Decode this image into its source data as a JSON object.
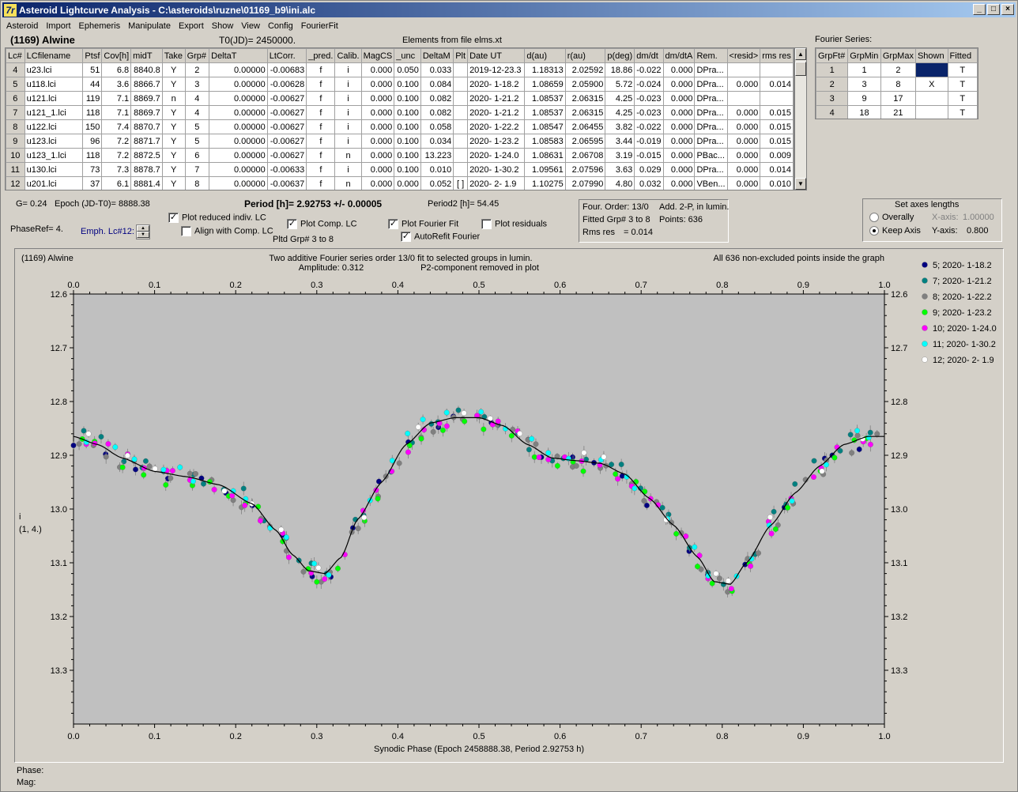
{
  "window": {
    "title": "Asteroid Lightcurve Analysis - C:\\asteroids\\ruzne\\01169_b9\\ini.alc",
    "icon": "7r"
  },
  "menu": [
    "Asteroid",
    "Import",
    "Ephemeris",
    "Manipulate",
    "Export",
    "Show",
    "View",
    "Config",
    "FourierFit"
  ],
  "header": {
    "asteroid": "(1169) Alwine",
    "t0": "T0(JD)= 2450000.",
    "elements": "Elements from file elms.xt",
    "fourier_series_label": "Fourier Series:"
  },
  "lc_table": {
    "columns": [
      "Lc#",
      "LCfilename",
      "Ptsf",
      "Cov[h]",
      "midT",
      "Take",
      "Grp#",
      "DeltaT",
      "LtCorr.",
      "_pred.",
      "Calib.",
      "MagCS",
      "_unc",
      "DeltaM",
      "Plt",
      "Date UT",
      "d(au)",
      "r(au)",
      "p(deg)",
      "dm/dt",
      "dm/dtA",
      "Rem.",
      "<resid>",
      "rms res"
    ],
    "rows": [
      [
        "4",
        "u23.lci",
        "51",
        "6.8",
        "8840.8",
        "Y",
        "2",
        "0.00000",
        "-0.00683",
        "f",
        "i",
        "0.000",
        "0.050",
        "0.033",
        "",
        "2019-12-23.3",
        "1.18313",
        "2.02592",
        "18.86",
        "-0.022",
        "0.000",
        "DPra...",
        "",
        ""
      ],
      [
        "5",
        "u118.lci",
        "44",
        "3.6",
        "8866.7",
        "Y",
        "3",
        "0.00000",
        "-0.00628",
        "f",
        "i",
        "0.000",
        "0.100",
        "0.084",
        "",
        "2020- 1-18.2",
        "1.08659",
        "2.05900",
        "5.72",
        "-0.024",
        "0.000",
        "DPra...",
        "0.000",
        "0.014"
      ],
      [
        "6",
        "u121.lci",
        "119",
        "7.1",
        "8869.7",
        "n",
        "4",
        "0.00000",
        "-0.00627",
        "f",
        "i",
        "0.000",
        "0.100",
        "0.082",
        "",
        "2020- 1-21.2",
        "1.08537",
        "2.06315",
        "4.25",
        "-0.023",
        "0.000",
        "DPra...",
        "",
        ""
      ],
      [
        "7",
        "u121_1.lci",
        "118",
        "7.1",
        "8869.7",
        "Y",
        "4",
        "0.00000",
        "-0.00627",
        "f",
        "i",
        "0.000",
        "0.100",
        "0.082",
        "",
        "2020- 1-21.2",
        "1.08537",
        "2.06315",
        "4.25",
        "-0.023",
        "0.000",
        "DPra...",
        "0.000",
        "0.015"
      ],
      [
        "8",
        "u122.lci",
        "150",
        "7.4",
        "8870.7",
        "Y",
        "5",
        "0.00000",
        "-0.00627",
        "f",
        "i",
        "0.000",
        "0.100",
        "0.058",
        "",
        "2020- 1-22.2",
        "1.08547",
        "2.06455",
        "3.82",
        "-0.022",
        "0.000",
        "DPra...",
        "0.000",
        "0.015"
      ],
      [
        "9",
        "u123.lci",
        "96",
        "7.2",
        "8871.7",
        "Y",
        "5",
        "0.00000",
        "-0.00627",
        "f",
        "i",
        "0.000",
        "0.100",
        "0.034",
        "",
        "2020- 1-23.2",
        "1.08583",
        "2.06595",
        "3.44",
        "-0.019",
        "0.000",
        "DPra...",
        "0.000",
        "0.015"
      ],
      [
        "10",
        "u123_1.lci",
        "118",
        "7.2",
        "8872.5",
        "Y",
        "6",
        "0.00000",
        "-0.00627",
        "f",
        "n",
        "0.000",
        "0.100",
        "13.223",
        "",
        "2020- 1-24.0",
        "1.08631",
        "2.06708",
        "3.19",
        "-0.015",
        "0.000",
        "PBac...",
        "0.000",
        "0.009"
      ],
      [
        "11",
        "u130.lci",
        "73",
        "7.3",
        "8878.7",
        "Y",
        "7",
        "0.00000",
        "-0.00633",
        "f",
        "i",
        "0.000",
        "0.100",
        "0.010",
        "",
        "2020- 1-30.2",
        "1.09561",
        "2.07596",
        "3.63",
        "0.029",
        "0.000",
        "DPra...",
        "0.000",
        "0.014"
      ],
      [
        "12",
        "u201.lci",
        "37",
        "6.1",
        "8881.4",
        "Y",
        "8",
        "0.00000",
        "-0.00637",
        "f",
        "n",
        "0.000",
        "0.000",
        "0.052",
        "[ ]",
        "2020- 2- 1.9",
        "1.10275",
        "2.07990",
        "4.80",
        "0.032",
        "0.000",
        "VBen...",
        "0.000",
        "0.010"
      ]
    ]
  },
  "fourier_table": {
    "columns": [
      "GrpFt#",
      "GrpMin",
      "GrpMax",
      "Shown",
      "Fitted"
    ],
    "rows": [
      [
        "1",
        "1",
        "2",
        "",
        "T"
      ],
      [
        "2",
        "3",
        "8",
        "X",
        "T"
      ],
      [
        "3",
        "9",
        "17",
        "",
        "T"
      ],
      [
        "4",
        "18",
        "21",
        "",
        "T"
      ]
    ]
  },
  "controls": {
    "g": "G= 0.24",
    "epoch": "Epoch (JD-T0)= 8888.38",
    "period": "Period [h]= 2.92753 +/- 0.00005",
    "period2": "Period2 [h]= 54.45",
    "phaseref": "PhaseRef= 4.",
    "emph": "Emph. Lc#12:",
    "plot_reduced": "Plot reduced indiv. LC",
    "align_comp": "Align with Comp. LC",
    "plot_comp": "Plot Comp. LC",
    "pltd_grp": "Pltd Grp#  3  to   8",
    "plot_fourier": "Plot Fourier Fit",
    "autorefit": "AutoRefit Fourier",
    "plot_residuals": "Plot residuals",
    "info": [
      "Four. Order: 13/0",
      "Add. 2-P, in lumin.",
      "Fitted Grp# 3 to 8",
      "Points: 636",
      "Rms res",
      "= 0.014"
    ],
    "axes_title": "Set axes lengths",
    "overally": "Overally",
    "keep_axis": "Keep Axis",
    "xaxis_label": "X-axis:",
    "xaxis_val": "1.00000",
    "yaxis_label": "Y-axis:",
    "yaxis_val": "0.800"
  },
  "plot": {
    "top_left": "(1169) Alwine",
    "caption1": "Two additive Fourier series order 13/0 fit to selected groups in lumin.",
    "caption2": "Amplitude: 0.312",
    "caption3": "P2-component removed in plot",
    "top_right": "All 636 non-excluded points inside the graph",
    "ylabel1": "i",
    "ylabel2": "(1, 4.)",
    "xlabel": "Synodic Phase (Epoch 2458888.38, Period 2.92753 h)",
    "phase_label": "Phase:",
    "mag_label": "Mag:"
  },
  "chart_data": {
    "type": "scatter",
    "xlim": [
      0.0,
      1.0
    ],
    "ylim": [
      13.4,
      12.6
    ],
    "x_ticks": [
      "0.0",
      "0.1",
      "0.2",
      "0.3",
      "0.4",
      "0.5",
      "0.6",
      "0.7",
      "0.8",
      "0.9",
      "1.0"
    ],
    "y_ticks": [
      "12.6",
      "12.7",
      "12.8",
      "12.9",
      "13.0",
      "13.1",
      "13.2",
      "13.3"
    ],
    "fit_curve": {
      "x": [
        0.0,
        0.03,
        0.06,
        0.1,
        0.14,
        0.18,
        0.22,
        0.25,
        0.27,
        0.29,
        0.31,
        0.33,
        0.35,
        0.38,
        0.41,
        0.44,
        0.47,
        0.5,
        0.53,
        0.56,
        0.59,
        0.62,
        0.65,
        0.68,
        0.71,
        0.74,
        0.77,
        0.79,
        0.81,
        0.83,
        0.86,
        0.89,
        0.92,
        0.95,
        0.98,
        1.0
      ],
      "y": [
        12.865,
        12.88,
        12.905,
        12.93,
        12.94,
        12.955,
        12.99,
        13.04,
        13.085,
        13.115,
        13.12,
        13.09,
        13.02,
        12.95,
        12.88,
        12.84,
        12.83,
        12.83,
        12.845,
        12.88,
        12.905,
        12.91,
        12.915,
        12.935,
        12.98,
        13.03,
        13.09,
        13.135,
        13.14,
        13.1,
        13.03,
        12.97,
        12.92,
        12.88,
        12.865,
        12.865
      ]
    },
    "series": [
      {
        "name": "5; 2020- 1-18.2",
        "color": "#000080",
        "offset": 0.004,
        "phase_from": 0.0,
        "phase_to": 1.0,
        "n": 30
      },
      {
        "name": "7; 2020- 1-21.2",
        "color": "#008080",
        "offset": -0.006,
        "phase_from": 0.0,
        "phase_to": 1.0,
        "n": 45
      },
      {
        "name": "8; 2020- 1-22.2",
        "color": "#808080",
        "offset": 0.006,
        "phase_from": 0.0,
        "phase_to": 1.0,
        "n": 55
      },
      {
        "name": "9; 2020- 1-23.2",
        "color": "#00ff00",
        "offset": 0.008,
        "phase_from": 0.0,
        "phase_to": 1.0,
        "n": 40
      },
      {
        "name": "10; 2020- 1-24.0",
        "color": "#ff00ff",
        "offset": 0.002,
        "phase_from": 0.0,
        "phase_to": 1.0,
        "n": 50
      },
      {
        "name": "11; 2020- 1-30.2",
        "color": "#00ffff",
        "offset": -0.004,
        "phase_from": 0.0,
        "phase_to": 1.0,
        "n": 35
      },
      {
        "name": "12; 2020- 2- 1.9",
        "color": "#ffffff",
        "offset": -0.002,
        "phase_from": 0.0,
        "phase_to": 1.0,
        "n": 20
      }
    ]
  }
}
